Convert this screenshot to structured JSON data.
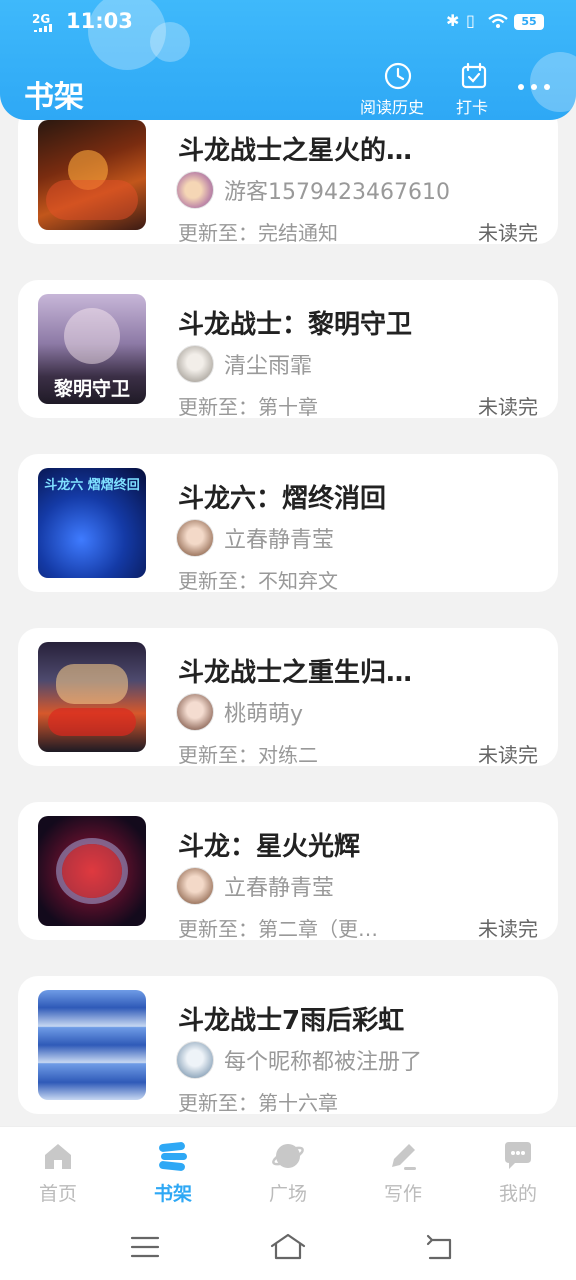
{
  "status_bar": {
    "signal": "2G",
    "time": "11:03",
    "battery": "55"
  },
  "header": {
    "title": "书架",
    "history_label": "阅读历史",
    "checkin_label": "打卡"
  },
  "books": [
    {
      "title": "斗龙战士之星火的…",
      "author": "游客1579423467610",
      "update_prefix": "更新至：",
      "update": "完结通知",
      "status": "未读完"
    },
    {
      "title": "斗龙战士：黎明守卫",
      "author": "清尘雨霏",
      "update_prefix": "更新至：",
      "update": "第十章",
      "status": "未读完",
      "cover_text": "黎明守卫"
    },
    {
      "title": "斗龙六：熠终消回",
      "author": "立春静青莹",
      "update_prefix": "更新至：",
      "update": "不知弃文",
      "status": "",
      "cover_text": "斗龙六 熠熠终回"
    },
    {
      "title": "斗龙战士之重生归…",
      "author": "桃萌萌y",
      "update_prefix": "更新至：",
      "update": "对练二",
      "status": "未读完"
    },
    {
      "title": "斗龙：星火光辉",
      "author": "立春静青莹",
      "update_prefix": "更新至：",
      "update": "第二章（更…",
      "status": "未读完"
    },
    {
      "title": "斗龙战士7雨后彩虹",
      "author": "每个昵称都被注册了",
      "update_prefix": "更新至：",
      "update": "第十六章",
      "status": ""
    }
  ],
  "tabs": [
    {
      "label": "首页",
      "icon": "home-icon"
    },
    {
      "label": "书架",
      "icon": "bookshelf-icon"
    },
    {
      "label": "广场",
      "icon": "planet-icon"
    },
    {
      "label": "写作",
      "icon": "pencil-icon"
    },
    {
      "label": "我的",
      "icon": "chat-bubble-icon"
    }
  ],
  "colors": {
    "accent": "#2ea8f5",
    "inactive": "#bbbbbb"
  }
}
